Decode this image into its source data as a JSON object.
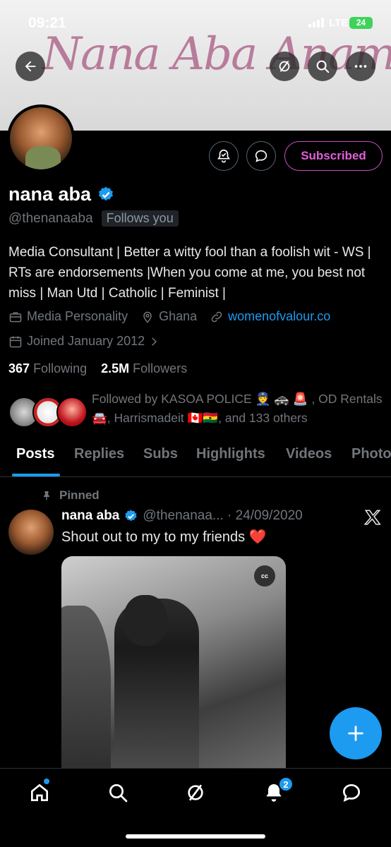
{
  "status_bar": {
    "time": "09:21",
    "network": "LTE",
    "battery": "24"
  },
  "banner": {
    "script_text": "Nana Aba Anamoah"
  },
  "header": {
    "back_icon": "back-arrow-icon",
    "grok_icon": "slash-circle-icon",
    "search_icon": "search-icon",
    "more_icon": "more-icon"
  },
  "profile_actions": {
    "subscribed_label": "Subscribed"
  },
  "profile": {
    "name": "nana aba",
    "handle": "@thenanaaba",
    "follows_you": "Follows you",
    "bio": "Media Consultant | Better a witty fool than a foolish wit - WS | RTs are endorsements |When you come at me, you best not miss | Man Utd | Catholic | Feminist |",
    "category": "Media Personality",
    "location": "Ghana",
    "website": "womenofvalour.co",
    "joined": "Joined January 2012",
    "following_count": "367",
    "following_label": "Following",
    "followers_count": "2.5M",
    "followers_label": "Followers",
    "followed_by": "Followed by KASOA POLICE 👮 🚓 🚨 , OD Rentals 🚘, Harrismadeit 🇨🇦🇬🇭, and 133 others"
  },
  "tabs": [
    "Posts",
    "Replies",
    "Subs",
    "Highlights",
    "Videos",
    "Photos"
  ],
  "post": {
    "pinned_label": "Pinned",
    "name": "nana aba",
    "handle_date": "@thenanaa... · 24/09/2020",
    "text": "Shout out to my to my friends",
    "emoji": "❤️",
    "cc_label": "cc"
  },
  "bottom_nav": {
    "notifications_badge": "2"
  },
  "colors": {
    "accent": "#1d9bf0",
    "subscribed": "#e05fd7",
    "muted": "#71767b"
  }
}
